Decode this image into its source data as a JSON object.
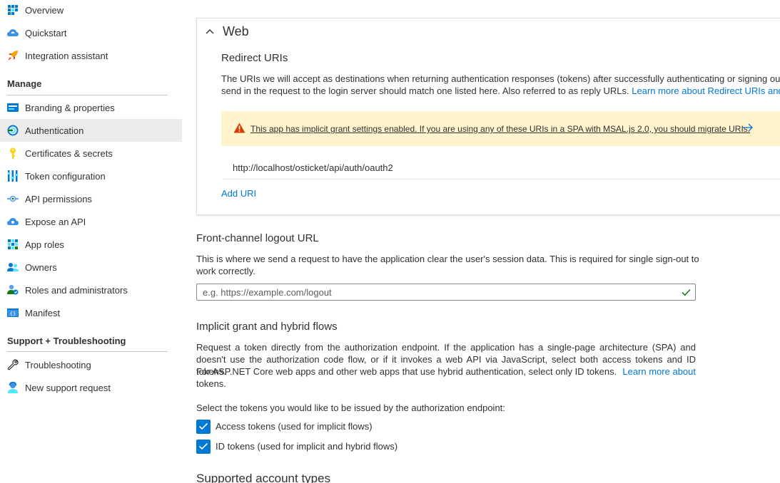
{
  "sidebar": {
    "top_items": [
      {
        "label": "Overview",
        "icon": "overview-grid-icon"
      },
      {
        "label": "Quickstart",
        "icon": "quickstart-cloud-icon"
      },
      {
        "label": "Integration assistant",
        "icon": "rocket-icon"
      }
    ],
    "manage_title": "Manage",
    "manage_items": [
      {
        "label": "Branding & properties",
        "icon": "branding-icon"
      },
      {
        "label": "Authentication",
        "icon": "authentication-icon"
      },
      {
        "label": "Certificates & secrets",
        "icon": "key-icon"
      },
      {
        "label": "Token configuration",
        "icon": "token-bars-icon"
      },
      {
        "label": "API permissions",
        "icon": "api-permissions-icon"
      },
      {
        "label": "Expose an API",
        "icon": "cloud-api-icon"
      },
      {
        "label": "App roles",
        "icon": "app-roles-grid-icon"
      },
      {
        "label": "Owners",
        "icon": "owners-people-icon"
      },
      {
        "label": "Roles and administrators",
        "icon": "roles-admin-icon"
      },
      {
        "label": "Manifest",
        "icon": "manifest-icon"
      }
    ],
    "support_title": "Support + Troubleshooting",
    "support_items": [
      {
        "label": "Troubleshooting",
        "icon": "wrench-icon"
      },
      {
        "label": "New support request",
        "icon": "support-person-icon"
      }
    ],
    "active_label": "Authentication"
  },
  "web_section": {
    "title": "Web",
    "redirect_title": "Redirect URIs",
    "redirect_desc_line1": "The URIs we will accept as destinations when returning authentication responses (tokens) after successfully authenticating or signing out",
    "redirect_desc_line2": "send in the request to the login server should match one listed here. Also referred to as reply URLs.",
    "redirect_learn_more": "Learn more about Redirect URIs and t",
    "warning_text": "This app has implicit grant settings enabled. If you are using any of these URIs in a SPA with MSAL.js 2.0, you should migrate URIs.",
    "redirect_uri": "http://localhost/osticket/api/auth/oauth2",
    "add_uri_label": "Add URI"
  },
  "logout_section": {
    "title": "Front-channel logout URL",
    "desc_line1": "This is where we send a request to have the application clear the user's session data. This is required for single sign-out to",
    "desc_line2": "work correctly.",
    "placeholder": "e.g. https://example.com/logout"
  },
  "implicit_section": {
    "title": "Implicit grant and hybrid flows",
    "desc_line1": "Request a token directly from the authorization endpoint. If the application has a single-page architecture (SPA) and",
    "desc_line2": "doesn't use the authorization code flow, or if it invokes a web API via JavaScript, select both access tokens and ID tokens.",
    "desc_line3": "For ASP.NET Core web apps and other web apps that use hybrid authentication, select only ID tokens.",
    "learn_more_a": "Learn more about",
    "learn_more_b": "tokens.",
    "select_prompt": "Select the tokens you would like to be issued by the authorization endpoint:",
    "access_tokens_label": "Access tokens (used for implicit flows)",
    "access_tokens_checked": true,
    "id_tokens_label": "ID tokens (used for implicit and hybrid flows)",
    "id_tokens_checked": true
  },
  "account_types_title": "Supported account types",
  "colors": {
    "accent": "#0078d4",
    "warning_bg": "#fff4ce",
    "warning_icon": "#d83b01",
    "active_nav_bg": "#edebe9",
    "valid_check": "#107c10"
  }
}
